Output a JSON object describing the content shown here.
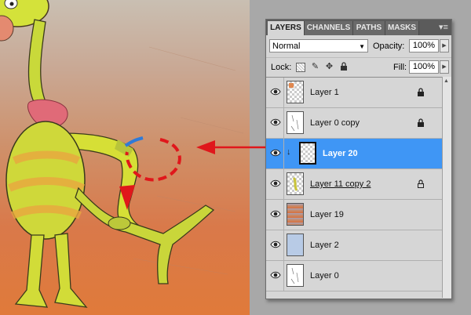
{
  "panel": {
    "tabs": [
      {
        "label": "LAYERS",
        "active": true
      },
      {
        "label": "CHANNELS",
        "active": false
      },
      {
        "label": "PATHS",
        "active": false
      },
      {
        "label": "MASKS",
        "active": false
      }
    ],
    "menu_icon": "panel-menu-icon",
    "blend_mode": "Normal",
    "opacity_label": "Opacity:",
    "opacity_value": "100%",
    "lock_label": "Lock:",
    "fill_label": "Fill:",
    "fill_value": "100%"
  },
  "layers": [
    {
      "name": "Layer 1",
      "visible": true,
      "locked": true,
      "selected": false,
      "thumb": "transparent"
    },
    {
      "name": "Layer 0 copy",
      "visible": true,
      "locked": true,
      "selected": false,
      "thumb": "sketch"
    },
    {
      "name": "Layer 20",
      "visible": true,
      "locked": false,
      "selected": true,
      "clipped": true,
      "thumb": "transparent"
    },
    {
      "name": "Layer 11 copy 2",
      "visible": true,
      "locked": true,
      "selected": false,
      "thumb": "transparent"
    },
    {
      "name": "Layer 19",
      "visible": true,
      "locked": false,
      "selected": false,
      "thumb": "gradient"
    },
    {
      "name": "Layer 2",
      "visible": true,
      "locked": false,
      "selected": false,
      "thumb": "blue"
    },
    {
      "name": "Layer 0",
      "visible": true,
      "locked": false,
      "selected": false,
      "thumb": "sketch"
    }
  ],
  "colors": {
    "selected_row": "#3f96f5",
    "annotation_red": "#e0171b",
    "highlight_blue": "#2f7ad8"
  }
}
